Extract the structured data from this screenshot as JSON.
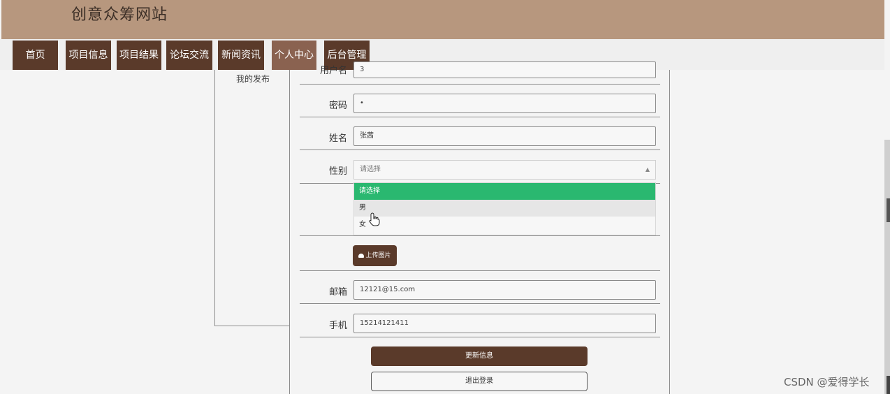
{
  "site": {
    "title": "创意众筹网站"
  },
  "nav": {
    "items": [
      {
        "label": "首页",
        "active": false
      },
      {
        "label": "项目信息",
        "active": false
      },
      {
        "label": "项目结果",
        "active": false
      },
      {
        "label": "论坛交流",
        "active": false
      },
      {
        "label": "新闻资讯",
        "active": false
      },
      {
        "label": "个人中心",
        "active": true
      },
      {
        "label": "后台管理",
        "active": false
      }
    ]
  },
  "sidebar": {
    "my_posts": "我的发布"
  },
  "form": {
    "username": {
      "label": "用户名",
      "value": "3"
    },
    "password": {
      "label": "密码",
      "value": "•"
    },
    "name": {
      "label": "姓名",
      "value": "张茜"
    },
    "gender": {
      "label": "性别",
      "value": "请选择",
      "options": [
        "请选择",
        "男",
        "女"
      ],
      "selected_index": 0,
      "hover_index": 1
    },
    "upload_label": "上传图片",
    "email": {
      "label": "邮箱",
      "value": "12121@15.com"
    },
    "phone": {
      "label": "手机",
      "value": "15214121411"
    },
    "update_label": "更新信息",
    "logout_label": "退出登录"
  },
  "watermark": "CSDN @爱得学长",
  "colors": {
    "header_bg": "#b7977e",
    "nav_bg": "#5a3a2a",
    "nav_active_bg": "#8a6250",
    "option_selected": "#2ab870"
  },
  "icons": {
    "upload": "cloud-upload-icon",
    "cursor": "hand-pointer-icon",
    "caret": "caret-up-icon"
  }
}
